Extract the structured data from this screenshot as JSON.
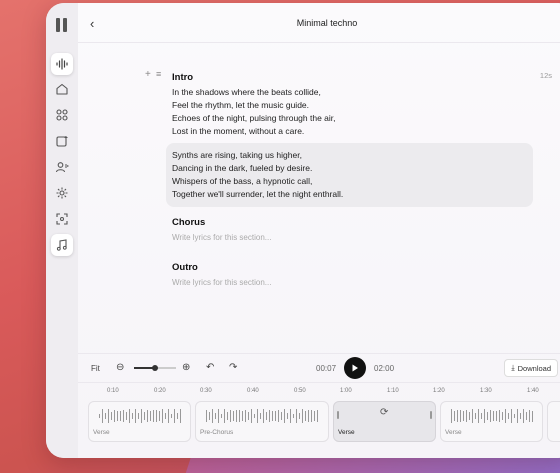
{
  "header": {
    "title": "Minimal techno",
    "back_glyph": "‹"
  },
  "sidebar": {
    "icons": [
      "waveform-icon",
      "home-icon",
      "grid-icon",
      "image-audio-icon",
      "voice-clone-icon",
      "settings-gear-icon",
      "scan-icon",
      "music-note-icon"
    ],
    "active_index": 0
  },
  "sections": {
    "intro": {
      "name": "Intro",
      "duration": "12s",
      "lines": [
        "In the shadows where the beats collide,",
        "Feel the rhythm, let the music guide.",
        "Echoes of the night, pulsing through the air,",
        "Lost in the moment, without a care."
      ]
    },
    "verse": {
      "lines": [
        "Synths are rising, taking us higher,",
        "Dancing in the dark, fueled by desire.",
        "Whispers of the bass, a hypnotic call,",
        "Together we'll surrender, let the night enthrall."
      ]
    },
    "chorus": {
      "name": "Chorus",
      "placeholder": "Write lyrics for this section..."
    },
    "outro": {
      "name": "Outro",
      "placeholder": "Write lyrics for this section..."
    }
  },
  "controls": {
    "fit_label": "Fit",
    "zoom_level": 0.5,
    "current_time": "00:07",
    "total_time": "02:00",
    "download_label": "Download"
  },
  "ruler": [
    "0:10",
    "0:20",
    "0:30",
    "0:40",
    "0:50",
    "1:00",
    "1:10",
    "1:20",
    "1:30",
    "1:40"
  ],
  "tracks": [
    {
      "label": "Verse"
    },
    {
      "label": "Pre-Chorus"
    },
    {
      "label": "Verse"
    },
    {
      "label": "Verse"
    }
  ],
  "colors": {
    "accent": "#111111",
    "bg_gradient_start": "#e4726c"
  }
}
